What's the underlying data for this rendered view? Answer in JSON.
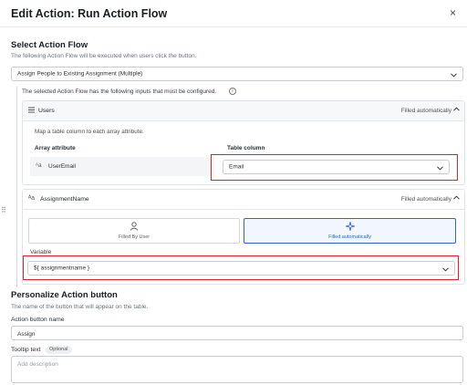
{
  "dialog": {
    "title": "Edit Action: Run Action Flow",
    "close": "×"
  },
  "select_flow": {
    "title": "Select Action Flow",
    "description": "The following Action Flow will be executed when users click the button.",
    "selected": "Assign People to Existing Assignment (Multiple)"
  },
  "inputs": {
    "info_text": "The selected Action Flow has the following inputs that must be configured.",
    "info_icon": "i"
  },
  "users_card": {
    "icon": "list-icon",
    "name": "Users",
    "status": "Filled automatically",
    "map_description": "Map a table column to each array attribute.",
    "col_attr": "Array attribute",
    "col_table": "Table column",
    "attr_name": "UserEmail",
    "column_value": "Email"
  },
  "assignment_card": {
    "icon": "text-type-icon",
    "name": "AssignmentName",
    "status": "Filled automatically",
    "options": [
      {
        "label": "Filled By User",
        "icon": "user-icon",
        "selected": false
      },
      {
        "label": "Filled automatically",
        "icon": "sparkle-icon",
        "selected": true
      }
    ],
    "variable_label": "Variable",
    "variable_value": "${ assignmentname }"
  },
  "personalize": {
    "title": "Personalize Action button",
    "description": "The name of the button that will appear on the table.",
    "name_label": "Action button name",
    "name_value": "Assign",
    "tooltip_label": "Tooltip text",
    "optional_badge": "Optional",
    "tooltip_placeholder": "Add description"
  },
  "colors": {
    "accent": "#2b65d9",
    "highlight": "#e3202c",
    "border": "#c9cdd3"
  }
}
